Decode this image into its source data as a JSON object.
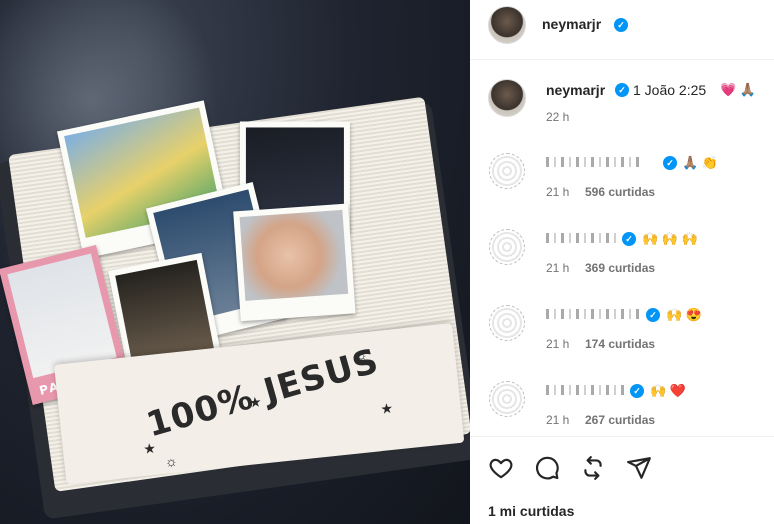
{
  "post": {
    "author": "neymarjr",
    "header_username": "neymarjr",
    "caption_text": "1 João 2:25",
    "caption_emojis": "💗 🙏🏽",
    "caption_time": "22 h",
    "photo": {
      "polaroid_label": "PAPAI",
      "banner_text": "100% JESUS"
    }
  },
  "comments": [
    {
      "emojis": "🙏🏽 👏",
      "time": "21 h",
      "likes": "596 curtidas"
    },
    {
      "emojis": "🙌 🙌 🙌",
      "time": "21 h",
      "likes": "369 curtidas"
    },
    {
      "emojis": "🙌 😍",
      "time": "21 h",
      "likes": "174 curtidas"
    },
    {
      "emojis": "🙌 ❤️",
      "time": "21 h",
      "likes": "267 curtidas"
    }
  ],
  "actions": {
    "icons": [
      "heart-icon",
      "comment-icon",
      "repost-icon",
      "share-icon"
    ],
    "likes_count": "1 mi curtidas"
  },
  "colors": {
    "verified": "#0095f6",
    "text": "#262626",
    "muted": "#737373",
    "divider": "#efefef"
  }
}
